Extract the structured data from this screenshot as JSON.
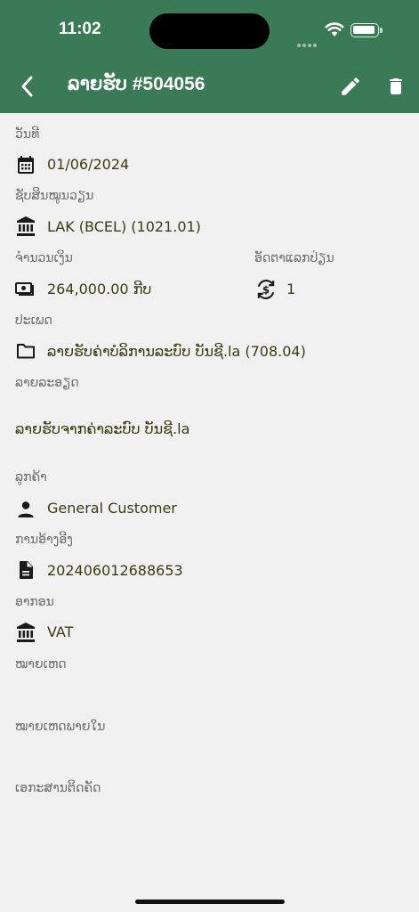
{
  "status_bar": {
    "time": "11:02"
  },
  "header": {
    "title": "ລາຍຮັບ #504056"
  },
  "fields": {
    "date": {
      "label": "ວັນທີ",
      "value": "01/06/2024"
    },
    "account": {
      "label": "ຊັບສິນໝູນວຽນ",
      "value": "LAK (BCEL) (1021.01)"
    },
    "amount": {
      "label": "ຈຳນວນເງິນ",
      "value": "264,000.00 ກີບ"
    },
    "rate": {
      "label": "ອັດຕາແລກປ່ຽນ",
      "value": "1"
    },
    "type": {
      "label": "ປະເພດ",
      "value": "ລາຍຮັບຄ່າບໍລິການລະບົບ ບັນຊີ.la (708.04)"
    },
    "description": {
      "label": "ລາຍລະອຽດ",
      "value": "ລາຍຮັບຈາກຄ່າລະບົບ ບັນຊີ.la"
    },
    "customer": {
      "label": "ລູກຄ້າ",
      "value": "General Customer"
    },
    "reference": {
      "label": "ການອ້າງອີງ",
      "value": "202406012688653"
    },
    "tax": {
      "label": "ອາກອນ",
      "value": "VAT"
    },
    "note": {
      "label": "ໝາຍເຫດ"
    },
    "internal_note": {
      "label": "ໝາຍເຫດພາຍໃນ"
    },
    "attachments": {
      "label": "ເອກະສານຕິດຄັດ"
    }
  },
  "icons": {
    "back": "chevron-left-icon",
    "edit": "pencil-icon",
    "delete": "trash-icon",
    "date": "calendar-icon",
    "account": "bank-icon",
    "amount": "cash-icon",
    "rate": "currency-exchange-icon",
    "type": "folder-icon",
    "customer": "person-icon",
    "reference": "document-icon",
    "tax": "bank-icon"
  },
  "colors": {
    "header_bg": "#3a7a56",
    "page_bg": "#f0f0f0",
    "value_text": "#3d3b10",
    "label_text": "#6e6e6e"
  }
}
